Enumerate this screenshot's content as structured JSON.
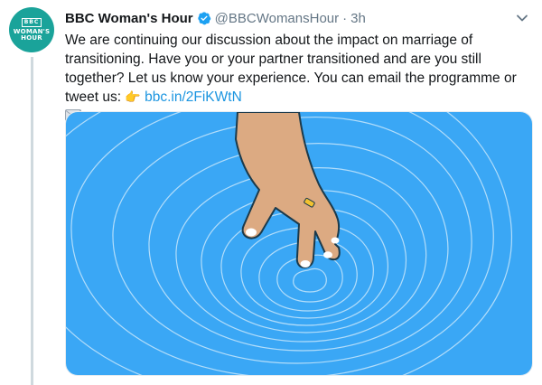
{
  "tweet": {
    "author_name": "BBC Woman's Hour",
    "handle": "@BBCWomansHour",
    "separator": "·",
    "time": "3h",
    "text_main": "We are continuing our discussion about the impact on marriage of transitioning. Have you or your partner transitioned and are you still together? Let us know your experience. You can email the programme or tweet us:",
    "pointing_emoji": "👉",
    "link": "bbc.in/2FiKWtN"
  },
  "avatar": {
    "line1": "BBC",
    "line2": "WOMAN'S",
    "line3": "HOUR",
    "color": "#1aa39a"
  },
  "colors": {
    "link": "#1b95e0",
    "verified": "#1da1f2",
    "water": "#3aa7f5",
    "skin": "#dcaa82"
  },
  "icons": [
    "verified-badge-icon",
    "chevron-down-icon",
    "envelope-icon"
  ]
}
